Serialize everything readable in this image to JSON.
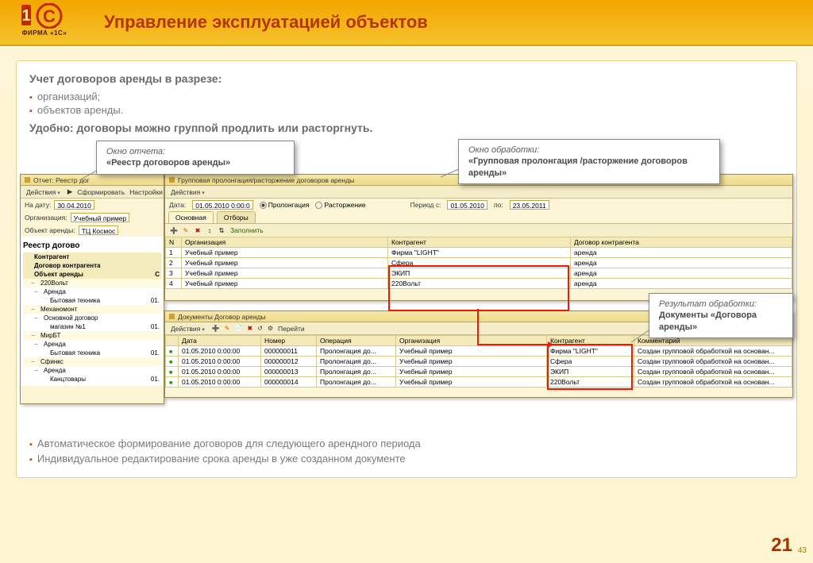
{
  "brand": {
    "name": "ФИРМА «1С»"
  },
  "slide": {
    "title": "Управление эксплуатацией объектов",
    "intro": "Учет договоров аренды в разрезе:",
    "intro_items": [
      "организаций;",
      "объектов аренды."
    ],
    "intro2": "Удобно: договоры можно группой продлить или расторгнуть.",
    "footer_items": [
      "Автоматическое формирование договоров для следующего арендного периода",
      "Индивидуальное редактирование срока аренды в уже созданном документе"
    ],
    "page": "21",
    "page_mini": "43"
  },
  "callouts": {
    "c1_label": "Окно отчета:",
    "c1_text": "«Реестр договоров аренды»",
    "c2_label": "Окно обработки:",
    "c2_text": "«Групповая пролонгация /расторжение договоров аренды»",
    "c3_label": "Результат обработки:",
    "c3_text": "Документы «Договора аренды»"
  },
  "report_win": {
    "title": "Отчет: Реестр дог",
    "toolbar": [
      "Действия",
      "Сформировать",
      "Настройки"
    ],
    "fields": {
      "date_label": "На дату:",
      "date_val": "30.04.2010",
      "org_label": "Организация:",
      "org_val": "Учебный пример",
      "obj_label": "Объект аренды:",
      "obj_val": "ТЦ Космос"
    },
    "heading": "Реестр догово",
    "tree_head": [
      "Контрагент",
      ""
    ],
    "tree_head2": [
      "Договор контрагента",
      ""
    ],
    "tree_head3": [
      "Объект аренды",
      "С"
    ],
    "rows": [
      {
        "lvl": 0,
        "name": "220Вольт"
      },
      {
        "lvl": 1,
        "name": "Аренда"
      },
      {
        "lvl": 2,
        "name": "Бытовая техника",
        "v": "01."
      },
      {
        "lvl": 0,
        "name": "Механомонт"
      },
      {
        "lvl": 1,
        "name": "Основной договор"
      },
      {
        "lvl": 2,
        "name": "магазин №1",
        "v": "01."
      },
      {
        "lvl": 0,
        "name": "МирБТ"
      },
      {
        "lvl": 1,
        "name": "Аренда"
      },
      {
        "lvl": 2,
        "name": "Бытовая техника",
        "v": "01."
      },
      {
        "lvl": 0,
        "name": "Сфинкс"
      },
      {
        "lvl": 1,
        "name": "Аренда"
      },
      {
        "lvl": 2,
        "name": "Канцтовары",
        "v": "01."
      }
    ]
  },
  "proc_win": {
    "title": "Групповая пролонгация/расторжение договоров аренды",
    "toolbar": [
      "Действия"
    ],
    "date_label": "Дата:",
    "date_val": "01.05.2010 0:00:0",
    "radio1": "Пролонгация",
    "radio2": "Расторжение",
    "period_label": "Период с:",
    "period_from": "01.05.2010",
    "period_to_label": "по:",
    "period_to": "23.05.2011",
    "tabs": [
      "Основная",
      "Отборы"
    ],
    "fill_btn": "Заполнить",
    "grid_head": [
      "N",
      "Организация",
      "Контрагент",
      "Договор контрагента"
    ],
    "grid_rows": [
      [
        "1",
        "Учебный пример",
        "Фирма \"LIGHT\"",
        "аренда"
      ],
      [
        "2",
        "Учебный пример",
        "Сфера",
        "аренда"
      ],
      [
        "3",
        "Учебный пример",
        "ЭКИП",
        "аренда"
      ],
      [
        "4",
        "Учебный пример",
        "220Вольт",
        "аренда"
      ]
    ]
  },
  "docs_win": {
    "title": "Документы Договор аренды",
    "toolbar": [
      "Действия"
    ],
    "goto": "Перейти",
    "grid_head": [
      "",
      "Дата",
      "Номер",
      "Операция",
      "Организация",
      "Контрагент",
      "Комментарий"
    ],
    "grid_rows": [
      [
        "",
        "01.05.2010 0:00:00",
        "000000011",
        "Пролонгация до...",
        "Учебный пример",
        "Фирма \"LIGHT\"",
        "Создан групповой обработкой на основан..."
      ],
      [
        "",
        "01.05.2010 0:00:00",
        "000000012",
        "Пролонгация до...",
        "Учебный пример",
        "Сфера",
        "Создан групповой обработкой на основан..."
      ],
      [
        "",
        "01.05.2010 0:00:00",
        "000000013",
        "Пролонгация до...",
        "Учебный пример",
        "ЭКИП",
        "Создан групповой обработкой на основан..."
      ],
      [
        "",
        "01.05.2010 0:00:00",
        "000000014",
        "Пролонгация до...",
        "Учебный пример",
        "220Вольт",
        "Создан групповой обработкой на основан..."
      ]
    ]
  }
}
